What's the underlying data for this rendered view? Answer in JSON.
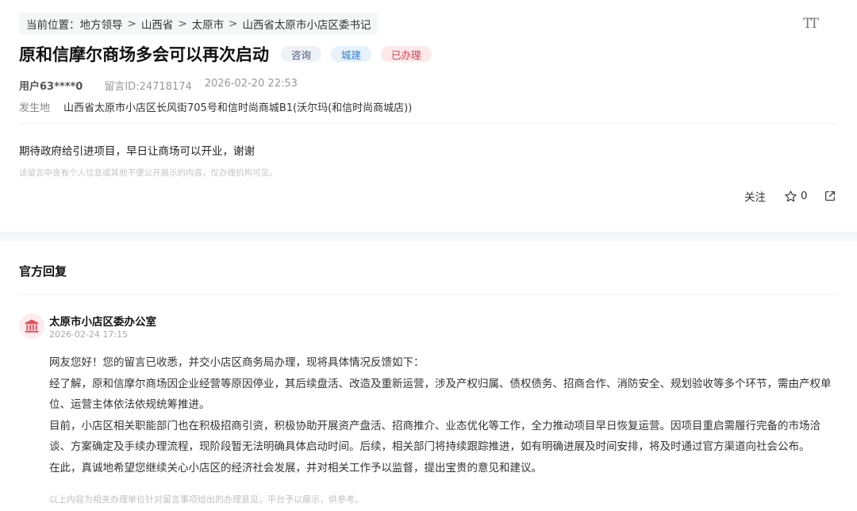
{
  "breadcrumb": {
    "prefix": "当前位置：",
    "items": [
      "地方领导",
      "山西省",
      "太原市",
      "山西省太原市小店区委书记"
    ],
    "separator": ">"
  },
  "toolbar": {
    "font_size_glyph": "TT"
  },
  "post": {
    "title": "原和信摩尔商场多会可以再次启动",
    "tags": {
      "consult": "咨询",
      "city": "城建",
      "status": "已办理"
    },
    "user": "用户63****0",
    "message_id": "留言ID:24718174",
    "datetime": "2026-02-20 22:53",
    "location_label": "发生地",
    "location": "山西省太原市小店区长风街705号和信时尚商城B1(沃尔玛(和信时尚商城店))",
    "content": "期待政府给引进项目，早日让商场可以开业，谢谢",
    "privacy_note": "该留言中含有个人信息或其他不便公开展示的内容，仅办理机构可见。"
  },
  "actions": {
    "follow_label": "关注",
    "star_count": "0"
  },
  "reply_section": {
    "title": "官方回复",
    "org_name": "太原市小店区委办公室",
    "time": "2026-02-24 17:15",
    "paragraphs": [
      "网友您好！您的留言已收悉，并交小店区商务局办理，现将具体情况反馈如下：",
      "经了解，原和信摩尔商场因企业经营等原因停业，其后续盘活、改造及重新运营，涉及产权归属、债权债务、招商合作、消防安全、规划验收等多个环节，需由产权单位、运营主体依法依规统筹推进。",
      "目前，小店区相关职能部门也在积极招商引资，积极协助开展资产盘活、招商推介、业态优化等工作，全力推动项目早日恢复运营。因项目重启需履行完备的市场洽谈、方案确定及手续办理流程，现阶段暂无法明确具体启动时间。后续，相关部门将持续跟踪推进，如有明确进展及时间安排，将及时通过官方渠道向社会公布。",
      "在此，真诚地希望您继续关心小店区的经济社会发展，并对相关工作予以监督，提出宝贵的意见和建议。"
    ],
    "footer_note": "以上内容为相关办理单位针对留言事项给出的办理意见，平台予以展示，供参考。"
  },
  "icons": {
    "font_size": "font-size-icon",
    "star": "star-icon",
    "share": "share-icon",
    "org": "government-building-icon"
  },
  "colors": {
    "tag_consult_text": "#4a5a78",
    "tag_city_text": "#2f7fd3",
    "tag_done_text": "#e0384a",
    "org_avatar_icon": "#e8505b"
  }
}
